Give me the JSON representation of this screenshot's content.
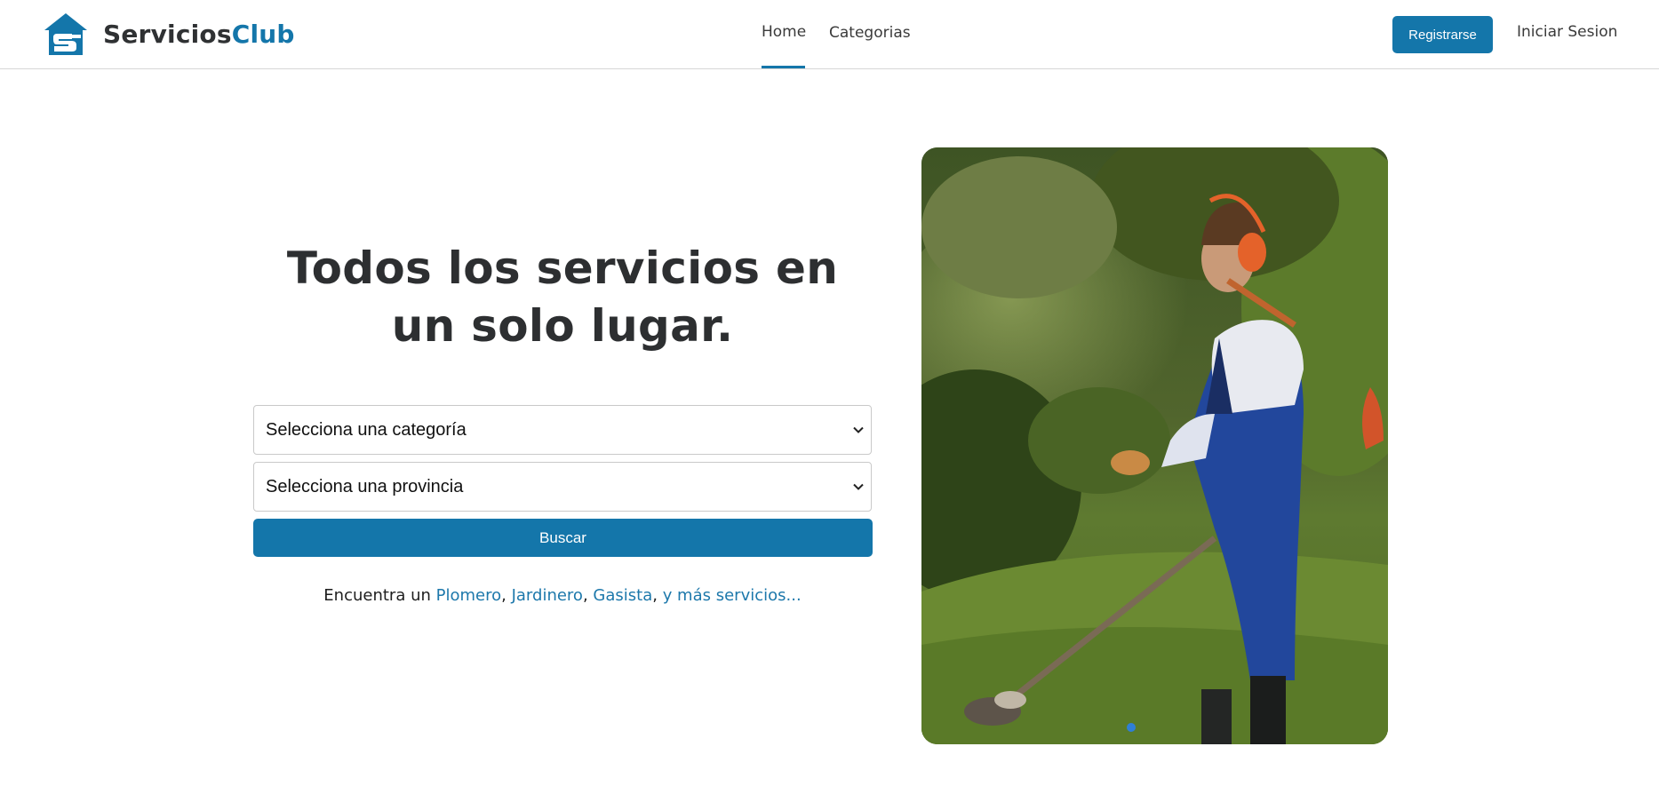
{
  "brand": {
    "name_part1": "Servicios",
    "name_part2": "Club",
    "color_dark": "#2f3133",
    "color_accent": "#1476aa"
  },
  "nav": {
    "home": "Home",
    "categories": "Categorias",
    "active": "Home"
  },
  "header_actions": {
    "register": "Registrarse",
    "login": "Iniciar Sesion"
  },
  "hero": {
    "title": "Todos los servicios en un solo lugar.",
    "category_select": {
      "selected": "Selecciona una categoría"
    },
    "province_select": {
      "selected": "Selecciona una provincia"
    },
    "search_button": "Buscar",
    "find_prefix": "Encuentra un",
    "links": [
      "Plomero",
      "Jardinero",
      "Gasista"
    ],
    "more_link": "y más servicios..."
  },
  "carousel": {
    "total_slides": 1,
    "active_index": 0
  }
}
